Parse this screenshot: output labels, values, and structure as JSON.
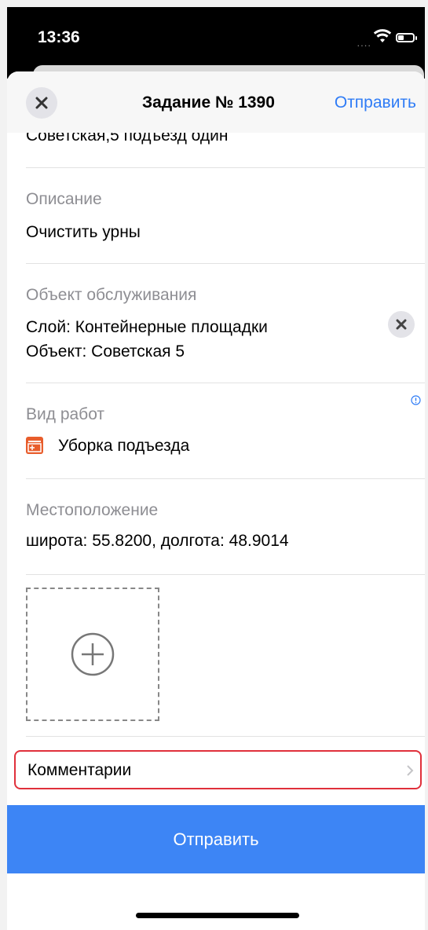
{
  "status_bar": {
    "time": "13:36",
    "signal": "....",
    "wifi_icon": "wifi-icon",
    "battery_icon": "battery-icon"
  },
  "nav": {
    "close_icon": "close-icon",
    "title": "Задание № 1390",
    "send_label": "Отправить"
  },
  "form": {
    "address_partial": "Советская,5 подъезд один",
    "description": {
      "label": "Описание",
      "value": "Очистить урны"
    },
    "service_object": {
      "label": "Объект обслуживания",
      "line1": "Слой: Контейнерные площадки",
      "line2": "Объект: Советская 5",
      "clear_icon": "clear-icon"
    },
    "work_type": {
      "label": "Вид работ",
      "value": "Уборка подъезда",
      "icon": "work-type-icon",
      "info_icon": "info-icon"
    },
    "location": {
      "label": "Местоположение",
      "value": "широта: 55.8200, долгота: 48.9014"
    },
    "photo": {
      "add_icon": "add-photo-icon"
    },
    "comments": {
      "label": "Комментарии",
      "chevron_icon": "chevron-right-icon"
    }
  },
  "submit": {
    "label": "Отправить"
  },
  "colors": {
    "accent": "#2f7cf6",
    "submit_bg": "#3d85f5",
    "highlight_border": "#e0303b",
    "work_icon": "#e85d2c"
  }
}
